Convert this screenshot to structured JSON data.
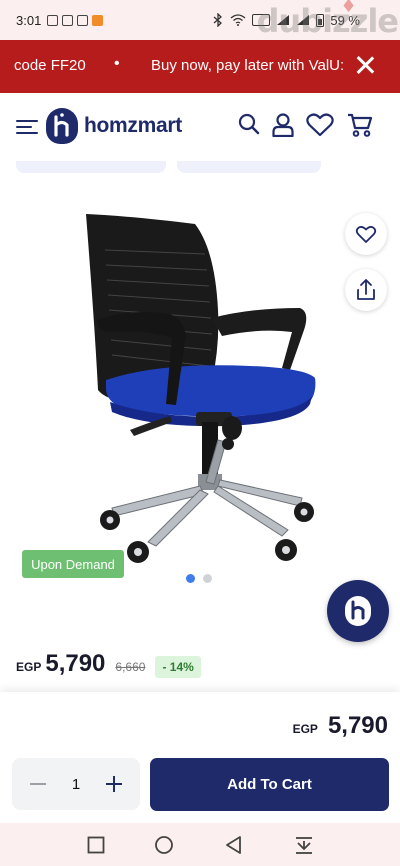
{
  "status_bar": {
    "time": "3:01",
    "battery": "59 %",
    "watermark": "dubizzle"
  },
  "promo": {
    "text_left": "code FF20",
    "separator": "•",
    "text_right": "Buy now, pay later with ValU:"
  },
  "header": {
    "logo_text": "homzmart"
  },
  "product": {
    "badge": "Upon Demand",
    "currency": "EGP",
    "price": "5,790",
    "old_price": "6,660",
    "discount": "- 14%"
  },
  "sticky": {
    "currency": "EGP",
    "price": "5,790",
    "quantity": "1",
    "add_to_cart": "Add To Cart"
  },
  "icons": {
    "menu": "menu-icon",
    "search": "search-icon",
    "account": "user-icon",
    "wishlist": "heart-icon",
    "cart": "cart-icon",
    "share": "share-icon"
  },
  "colors": {
    "brand": "#1f2a6b",
    "promo_bg": "#b71c1c",
    "badge_bg": "#6fbf73",
    "discount_bg": "#dcf3dc",
    "discount_text": "#2e7d32"
  }
}
